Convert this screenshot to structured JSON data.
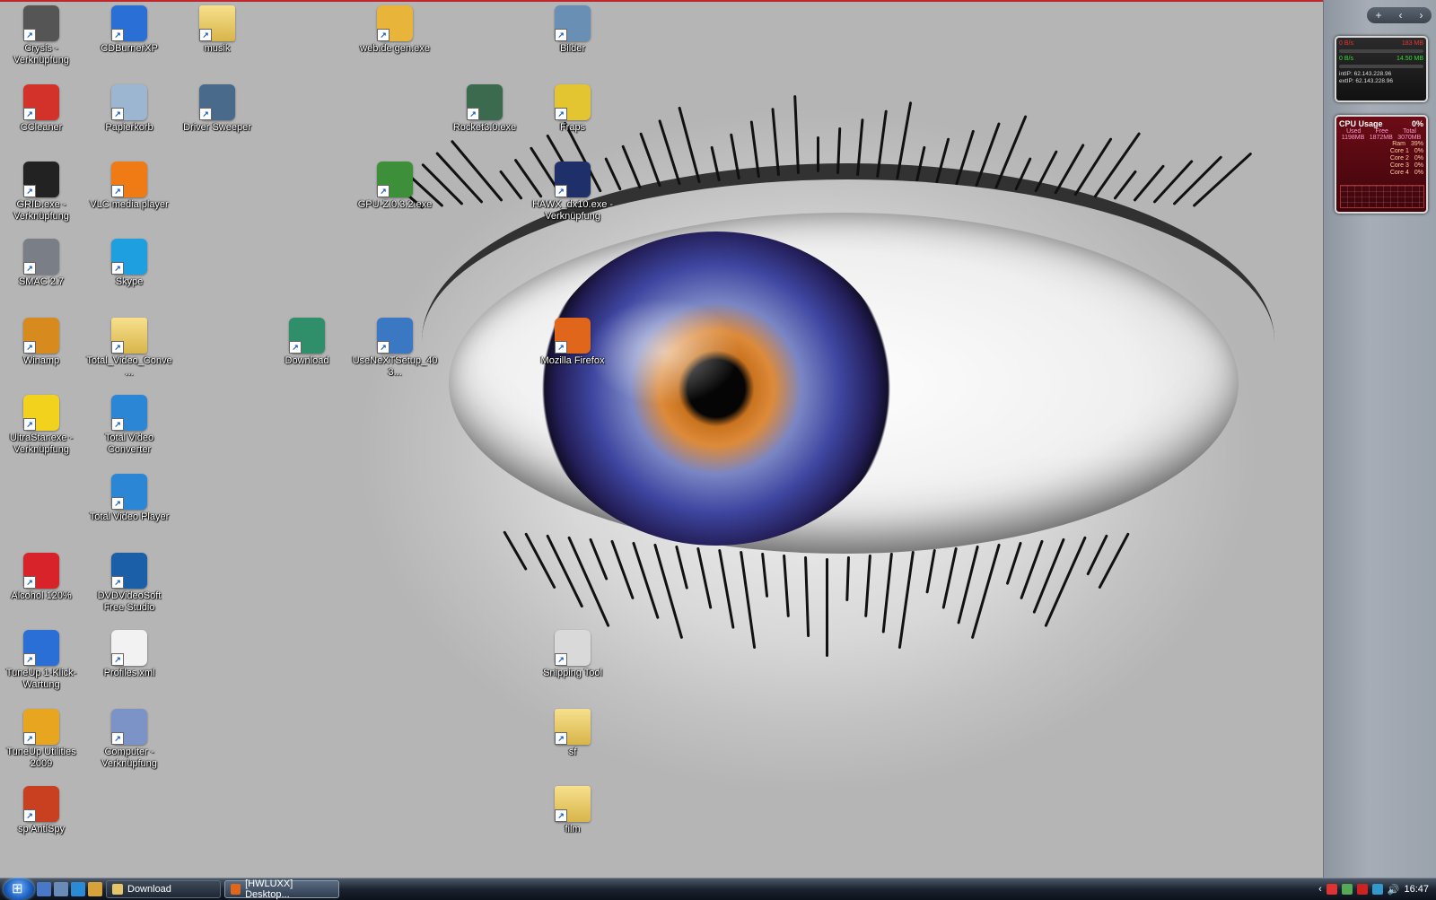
{
  "desktop_icons": [
    {
      "name": "crysis",
      "label": "Crysis - Verknüpfung",
      "color": "#555"
    },
    {
      "name": "cdburnerxp",
      "label": "CDBurnerXP",
      "color": "#2a6fd6"
    },
    {
      "name": "musik",
      "label": "musik",
      "color": "#e5c56a"
    },
    {
      "name": "webde",
      "label": "web.de gen.exe",
      "color": "#e8b43a"
    },
    {
      "name": "bilder",
      "label": "Bilder",
      "color": "#6a8fb5"
    },
    {
      "name": "ccleaner",
      "label": "CCleaner",
      "color": "#d3322a"
    },
    {
      "name": "papierkorb",
      "label": "Papierkorb",
      "color": "#9cb5d0"
    },
    {
      "name": "driver-sweeper",
      "label": "Driver Sweeper",
      "color": "#4a6a8c"
    },
    {
      "name": "rocket",
      "label": "Rocket3.0.exe",
      "color": "#3c6a4f"
    },
    {
      "name": "fraps",
      "label": "Fraps",
      "color": "#e3c431"
    },
    {
      "name": "grid",
      "label": "GRID.exe - Verknüpfung",
      "color": "#222"
    },
    {
      "name": "vlc",
      "label": "VLC media player",
      "color": "#f07a13"
    },
    {
      "name": "gpuz",
      "label": "GPU-Z.0.3.2.exe",
      "color": "#3e8f3a"
    },
    {
      "name": "hawx",
      "label": "HAWX_dx10.exe - Verknüpfung",
      "color": "#1f2f6a"
    },
    {
      "name": "smac",
      "label": "SMAC 2.7",
      "color": "#7a7f87"
    },
    {
      "name": "skype",
      "label": "Skype",
      "color": "#1ea0e0"
    },
    {
      "name": "winamp",
      "label": "Winamp",
      "color": "#d78b1f"
    },
    {
      "name": "total-video-conve",
      "label": "Total_Video_Conve...",
      "color": "#e5c56a"
    },
    {
      "name": "download",
      "label": "Download",
      "color": "#2f8f6a"
    },
    {
      "name": "usenext",
      "label": "UseNeXTSetup_403...",
      "color": "#3a78c4"
    },
    {
      "name": "firefox",
      "label": "Mozilla Firefox",
      "color": "#e0661c"
    },
    {
      "name": "ultrastar",
      "label": "UltraStar.exe - Verknüpfung",
      "color": "#f2d21d"
    },
    {
      "name": "total-video-converter",
      "label": "Total Video Converter",
      "color": "#2c86d6"
    },
    {
      "name": "total-video-player",
      "label": "Total Video Player",
      "color": "#2c86d6"
    },
    {
      "name": "alcohol",
      "label": "Alcohol 120%",
      "color": "#d8232a"
    },
    {
      "name": "dvdvideosoft",
      "label": "DVDVideoSoft Free Studio",
      "color": "#1b5fa8"
    },
    {
      "name": "tuneup-1klick",
      "label": "TuneUp 1-Klick-Wartung",
      "color": "#2a6fd6"
    },
    {
      "name": "profiles",
      "label": "Profiles.xml",
      "color": "#f2f2f2"
    },
    {
      "name": "snipping-tool",
      "label": "Snipping Tool",
      "color": "#d9d9d9"
    },
    {
      "name": "tuneup-utilities",
      "label": "TuneUp Utilities 2009",
      "color": "#e7a520"
    },
    {
      "name": "computer",
      "label": "Computer - Verknüpfung",
      "color": "#7b93c7"
    },
    {
      "name": "sf",
      "label": "sf",
      "color": "#e5c56a"
    },
    {
      "name": "spyspy",
      "label": "sp AntiSpy",
      "color": "#c94021"
    },
    {
      "name": "filme",
      "label": "film",
      "color": "#e5c56a"
    }
  ],
  "network_gadget": {
    "up_left": "0 B/s",
    "up_right": "183 MB",
    "down_left": "0 B/s",
    "down_right": "14.50 MB",
    "int_ip": "intIP: 62.143.228.96",
    "ext_ip": "extIP: 62.143.228.96"
  },
  "cpu_gadget": {
    "title": "CPU Usage",
    "percent": "0%",
    "used_label": "Used",
    "free_label": "Free",
    "total_label": "Total",
    "used": "1198MB",
    "free": "1872MB",
    "total": "3070MB",
    "ram_label": "Ram",
    "ram_pct": "39%",
    "cores": [
      {
        "label": "Core 1",
        "value": "0%"
      },
      {
        "label": "Core 2",
        "value": "0%"
      },
      {
        "label": "Core 3",
        "value": "0%"
      },
      {
        "label": "Core 4",
        "value": "0%"
      }
    ]
  },
  "taskbar": {
    "tasks": [
      {
        "label": "Download",
        "active": false
      },
      {
        "label": "[HWLUXX] Desktop...",
        "active": true
      }
    ],
    "clock": "16:47"
  },
  "sidebar": {
    "add": "+",
    "prev": "‹",
    "next": "›"
  }
}
